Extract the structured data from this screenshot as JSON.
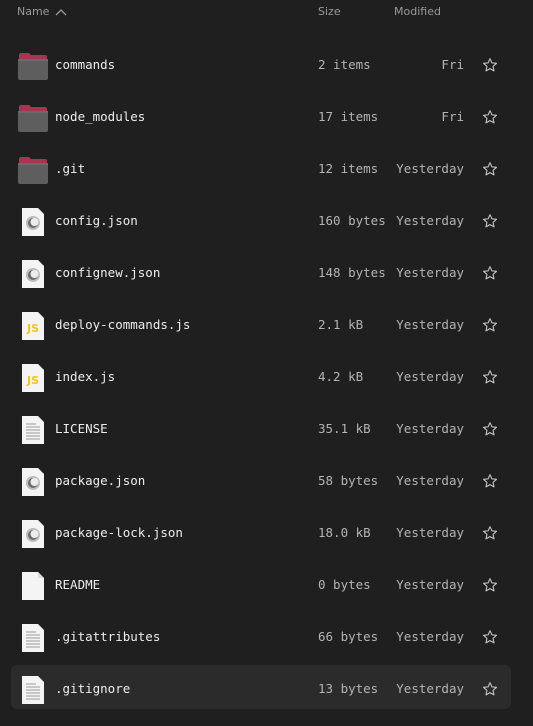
{
  "header": {
    "name_label": "Name",
    "size_label": "Size",
    "modified_label": "Modified",
    "sort_direction": "ascending"
  },
  "files": [
    {
      "name": "commands",
      "size": "2 items",
      "modified": "Fri",
      "icon": "folder-icon",
      "kind": "folder"
    },
    {
      "name": "node_modules",
      "size": "17 items",
      "modified": "Fri",
      "icon": "folder-icon",
      "kind": "folder"
    },
    {
      "name": ".git",
      "size": "12 items",
      "modified": "Yesterday",
      "icon": "folder-icon",
      "kind": "folder"
    },
    {
      "name": "config.json",
      "size": "160 bytes",
      "modified": "Yesterday",
      "icon": "json-file-icon",
      "kind": "json"
    },
    {
      "name": "confignew.json",
      "size": "148 bytes",
      "modified": "Yesterday",
      "icon": "json-file-icon",
      "kind": "json"
    },
    {
      "name": "deploy-commands.js",
      "size": "2.1 kB",
      "modified": "Yesterday",
      "icon": "js-file-icon",
      "kind": "js"
    },
    {
      "name": "index.js",
      "size": "4.2 kB",
      "modified": "Yesterday",
      "icon": "js-file-icon",
      "kind": "js"
    },
    {
      "name": "LICENSE",
      "size": "35.1 kB",
      "modified": "Yesterday",
      "icon": "text-file-icon",
      "kind": "text"
    },
    {
      "name": "package.json",
      "size": "58 bytes",
      "modified": "Yesterday",
      "icon": "json-file-icon",
      "kind": "json"
    },
    {
      "name": "package-lock.json",
      "size": "18.0 kB",
      "modified": "Yesterday",
      "icon": "json-file-icon",
      "kind": "json"
    },
    {
      "name": "README",
      "size": "0 bytes",
      "modified": "Yesterday",
      "icon": "blank-file-icon",
      "kind": "blank"
    },
    {
      "name": ".gitattributes",
      "size": "66 bytes",
      "modified": "Yesterday",
      "icon": "text-file-icon",
      "kind": "text"
    },
    {
      "name": ".gitignore",
      "size": "13 bytes",
      "modified": "Yesterday",
      "icon": "text-file-icon",
      "kind": "text",
      "selected": true
    }
  ],
  "colors": {
    "background": "#1f1f1f",
    "selected_row": "#2b2b2b",
    "folder_tab": "#a8344f",
    "folder_body": "#5e5e5e",
    "js_badge": "#f5c518"
  }
}
